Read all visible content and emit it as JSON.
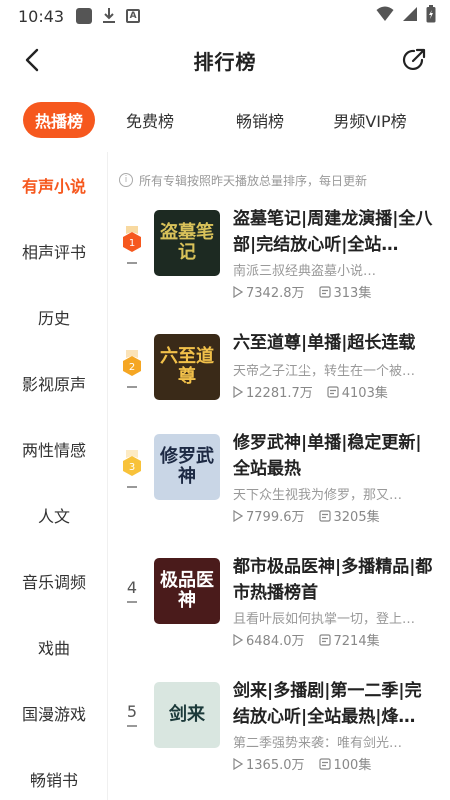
{
  "status": {
    "time": "10:43"
  },
  "header": {
    "title": "排行榜"
  },
  "tabs": [
    {
      "label": "热播榜",
      "active": true
    },
    {
      "label": "免费榜"
    },
    {
      "label": "畅销榜"
    },
    {
      "label": "男频VIP榜"
    }
  ],
  "categories": [
    {
      "label": "有声小说",
      "active": true
    },
    {
      "label": "相声评书"
    },
    {
      "label": "历史"
    },
    {
      "label": "影视原声"
    },
    {
      "label": "两性情感"
    },
    {
      "label": "人文"
    },
    {
      "label": "音乐调频"
    },
    {
      "label": "戏曲"
    },
    {
      "label": "国漫游戏"
    },
    {
      "label": "畅销书"
    }
  ],
  "notice": "所有专辑按照昨天播放总量排序，每日更新",
  "items": [
    {
      "rank": "1",
      "title": "盗墓笔记|周建龙演播|全八部|完结放心听|全站…",
      "desc": "南派三叔经典盗墓小说…",
      "plays": "7342.8万",
      "episodes": "313集",
      "cover_text": "盗墓笔记",
      "cover_bg": "#1d2a22",
      "cover_fg": "#d9c25a"
    },
    {
      "rank": "2",
      "title": "六至道尊|单播|超长连载",
      "desc": "天帝之子江尘，转生在一个被…",
      "plays": "12281.7万",
      "episodes": "4103集",
      "cover_text": "六至道尊",
      "cover_bg": "#3a2a18",
      "cover_fg": "#f2c14a"
    },
    {
      "rank": "3",
      "title": "修罗武神|单播|稳定更新|全站最热",
      "desc": "天下众生视我为修罗，那又…",
      "plays": "7799.6万",
      "episodes": "3205集",
      "cover_text": "修罗武神",
      "cover_bg": "#c9d6e6",
      "cover_fg": "#1d2a44"
    },
    {
      "rank": "4",
      "title": "都市极品医神|多播精品|都市热播榜首",
      "desc": "且看叶辰如何执掌一切，登上…",
      "plays": "6484.0万",
      "episodes": "7214集",
      "cover_text": "极品医神",
      "cover_bg": "#4a1b1b",
      "cover_fg": "#ffffff"
    },
    {
      "rank": "5",
      "title": "剑来|多播剧|第一二季|完结放心听|全站最热|烽…",
      "desc": "第二季强势来袭：唯有剑光…",
      "plays": "1365.0万",
      "episodes": "100集",
      "cover_text": "剑来",
      "cover_bg": "#d9e6e0",
      "cover_fg": "#1c3a3a"
    }
  ],
  "colors": {
    "accent": "#f6581e",
    "medal": "#f5a623"
  }
}
